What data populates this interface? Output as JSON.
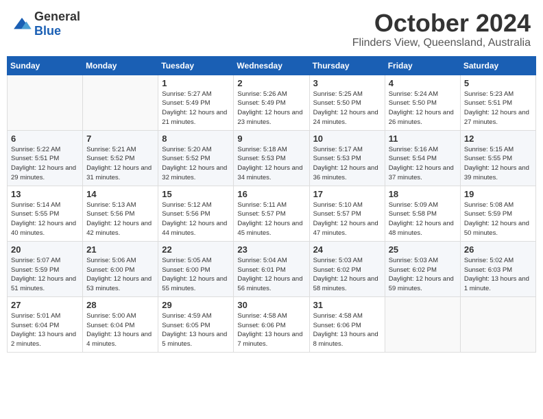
{
  "header": {
    "logo_general": "General",
    "logo_blue": "Blue",
    "month_title": "October 2024",
    "location": "Flinders View, Queensland, Australia"
  },
  "weekdays": [
    "Sunday",
    "Monday",
    "Tuesday",
    "Wednesday",
    "Thursday",
    "Friday",
    "Saturday"
  ],
  "weeks": [
    [
      {
        "day": "",
        "info": ""
      },
      {
        "day": "",
        "info": ""
      },
      {
        "day": "1",
        "info": "Sunrise: 5:27 AM\nSunset: 5:49 PM\nDaylight: 12 hours and 21 minutes."
      },
      {
        "day": "2",
        "info": "Sunrise: 5:26 AM\nSunset: 5:49 PM\nDaylight: 12 hours and 23 minutes."
      },
      {
        "day": "3",
        "info": "Sunrise: 5:25 AM\nSunset: 5:50 PM\nDaylight: 12 hours and 24 minutes."
      },
      {
        "day": "4",
        "info": "Sunrise: 5:24 AM\nSunset: 5:50 PM\nDaylight: 12 hours and 26 minutes."
      },
      {
        "day": "5",
        "info": "Sunrise: 5:23 AM\nSunset: 5:51 PM\nDaylight: 12 hours and 27 minutes."
      }
    ],
    [
      {
        "day": "6",
        "info": "Sunrise: 5:22 AM\nSunset: 5:51 PM\nDaylight: 12 hours and 29 minutes."
      },
      {
        "day": "7",
        "info": "Sunrise: 5:21 AM\nSunset: 5:52 PM\nDaylight: 12 hours and 31 minutes."
      },
      {
        "day": "8",
        "info": "Sunrise: 5:20 AM\nSunset: 5:52 PM\nDaylight: 12 hours and 32 minutes."
      },
      {
        "day": "9",
        "info": "Sunrise: 5:18 AM\nSunset: 5:53 PM\nDaylight: 12 hours and 34 minutes."
      },
      {
        "day": "10",
        "info": "Sunrise: 5:17 AM\nSunset: 5:53 PM\nDaylight: 12 hours and 36 minutes."
      },
      {
        "day": "11",
        "info": "Sunrise: 5:16 AM\nSunset: 5:54 PM\nDaylight: 12 hours and 37 minutes."
      },
      {
        "day": "12",
        "info": "Sunrise: 5:15 AM\nSunset: 5:55 PM\nDaylight: 12 hours and 39 minutes."
      }
    ],
    [
      {
        "day": "13",
        "info": "Sunrise: 5:14 AM\nSunset: 5:55 PM\nDaylight: 12 hours and 40 minutes."
      },
      {
        "day": "14",
        "info": "Sunrise: 5:13 AM\nSunset: 5:56 PM\nDaylight: 12 hours and 42 minutes."
      },
      {
        "day": "15",
        "info": "Sunrise: 5:12 AM\nSunset: 5:56 PM\nDaylight: 12 hours and 44 minutes."
      },
      {
        "day": "16",
        "info": "Sunrise: 5:11 AM\nSunset: 5:57 PM\nDaylight: 12 hours and 45 minutes."
      },
      {
        "day": "17",
        "info": "Sunrise: 5:10 AM\nSunset: 5:57 PM\nDaylight: 12 hours and 47 minutes."
      },
      {
        "day": "18",
        "info": "Sunrise: 5:09 AM\nSunset: 5:58 PM\nDaylight: 12 hours and 48 minutes."
      },
      {
        "day": "19",
        "info": "Sunrise: 5:08 AM\nSunset: 5:59 PM\nDaylight: 12 hours and 50 minutes."
      }
    ],
    [
      {
        "day": "20",
        "info": "Sunrise: 5:07 AM\nSunset: 5:59 PM\nDaylight: 12 hours and 51 minutes."
      },
      {
        "day": "21",
        "info": "Sunrise: 5:06 AM\nSunset: 6:00 PM\nDaylight: 12 hours and 53 minutes."
      },
      {
        "day": "22",
        "info": "Sunrise: 5:05 AM\nSunset: 6:00 PM\nDaylight: 12 hours and 55 minutes."
      },
      {
        "day": "23",
        "info": "Sunrise: 5:04 AM\nSunset: 6:01 PM\nDaylight: 12 hours and 56 minutes."
      },
      {
        "day": "24",
        "info": "Sunrise: 5:03 AM\nSunset: 6:02 PM\nDaylight: 12 hours and 58 minutes."
      },
      {
        "day": "25",
        "info": "Sunrise: 5:03 AM\nSunset: 6:02 PM\nDaylight: 12 hours and 59 minutes."
      },
      {
        "day": "26",
        "info": "Sunrise: 5:02 AM\nSunset: 6:03 PM\nDaylight: 13 hours and 1 minute."
      }
    ],
    [
      {
        "day": "27",
        "info": "Sunrise: 5:01 AM\nSunset: 6:04 PM\nDaylight: 13 hours and 2 minutes."
      },
      {
        "day": "28",
        "info": "Sunrise: 5:00 AM\nSunset: 6:04 PM\nDaylight: 13 hours and 4 minutes."
      },
      {
        "day": "29",
        "info": "Sunrise: 4:59 AM\nSunset: 6:05 PM\nDaylight: 13 hours and 5 minutes."
      },
      {
        "day": "30",
        "info": "Sunrise: 4:58 AM\nSunset: 6:06 PM\nDaylight: 13 hours and 7 minutes."
      },
      {
        "day": "31",
        "info": "Sunrise: 4:58 AM\nSunset: 6:06 PM\nDaylight: 13 hours and 8 minutes."
      },
      {
        "day": "",
        "info": ""
      },
      {
        "day": "",
        "info": ""
      }
    ]
  ]
}
